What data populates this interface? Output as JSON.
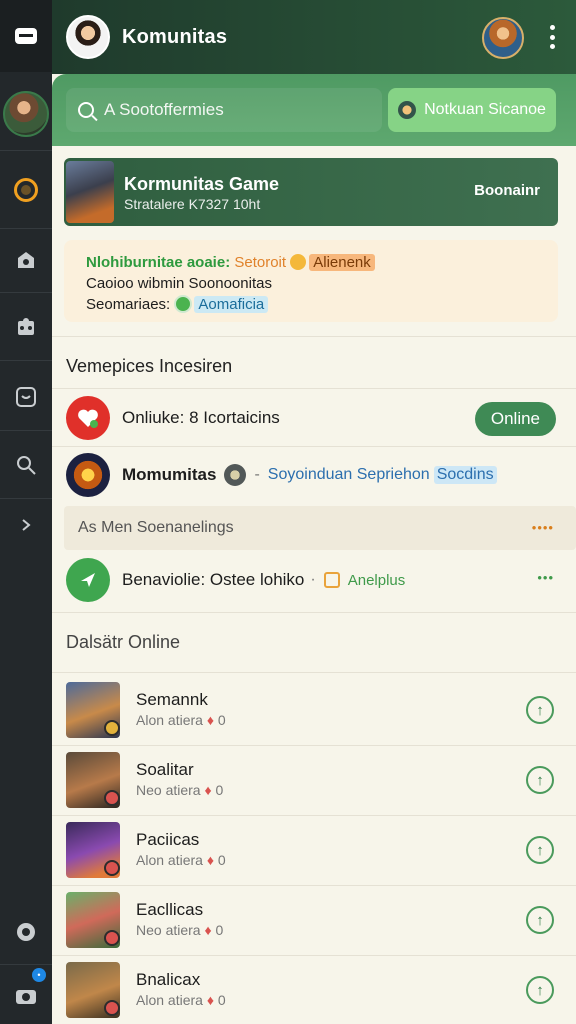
{
  "header": {
    "title": "Komunitas"
  },
  "search": {
    "placeholder": "A Sootoffermies"
  },
  "notif_button": {
    "label": "Notkuan Sicanoe"
  },
  "game_card": {
    "title": "Kormunitas Game",
    "subtitle": "Stratalere K7327 10ht",
    "action": "Boonainr"
  },
  "announcement": {
    "line1_green": "Nlohiburnitae aoaie:",
    "line1_orange": "Setoroit",
    "line1_chip": "Alienenk",
    "line2": "Caoioo wibmin Soonoonitas",
    "line3_prefix": "Seomariaes:",
    "line3_chip": "Aomaficia"
  },
  "section1": {
    "title": "Vemepices Incesiren"
  },
  "rows": {
    "online": {
      "label": "Onliuke: 8 Icortaicins",
      "pill": "Online"
    },
    "komunitas": {
      "label": "Momumitas",
      "meta": "Soyoinduan Sepriehon",
      "chip": "Socdins"
    },
    "banner": {
      "label": "As Men Soenanelings",
      "dots": "••••"
    },
    "benaviolie": {
      "label": "Benaviolie: Ostee lohiko",
      "meta": "Anelplus",
      "dots": "•••"
    }
  },
  "section2": {
    "title": "Dalsätr Online"
  },
  "friends": [
    {
      "name": "Semannk",
      "sub_a": "Alon atiera",
      "sub_b": "0"
    },
    {
      "name": "Soalitar",
      "sub_a": "Neo atiera",
      "sub_b": "0"
    },
    {
      "name": "Paciicas",
      "sub_a": "Alon atiera",
      "sub_b": "0"
    },
    {
      "name": "Eacllicas",
      "sub_a": "Neo atiera",
      "sub_b": "0"
    },
    {
      "name": "Bnalicax",
      "sub_a": "Alon atiera",
      "sub_b": "0"
    }
  ],
  "colors": {
    "header": "#2c5a3b",
    "accent_green": "#3f8a55",
    "rail": "#23282b"
  },
  "icons": [
    "cards-icon",
    "ring-icon",
    "bell-icon",
    "puzzle-icon",
    "chat-icon",
    "search-icon",
    "chevron-right-icon",
    "smile-icon",
    "camera-icon"
  ]
}
